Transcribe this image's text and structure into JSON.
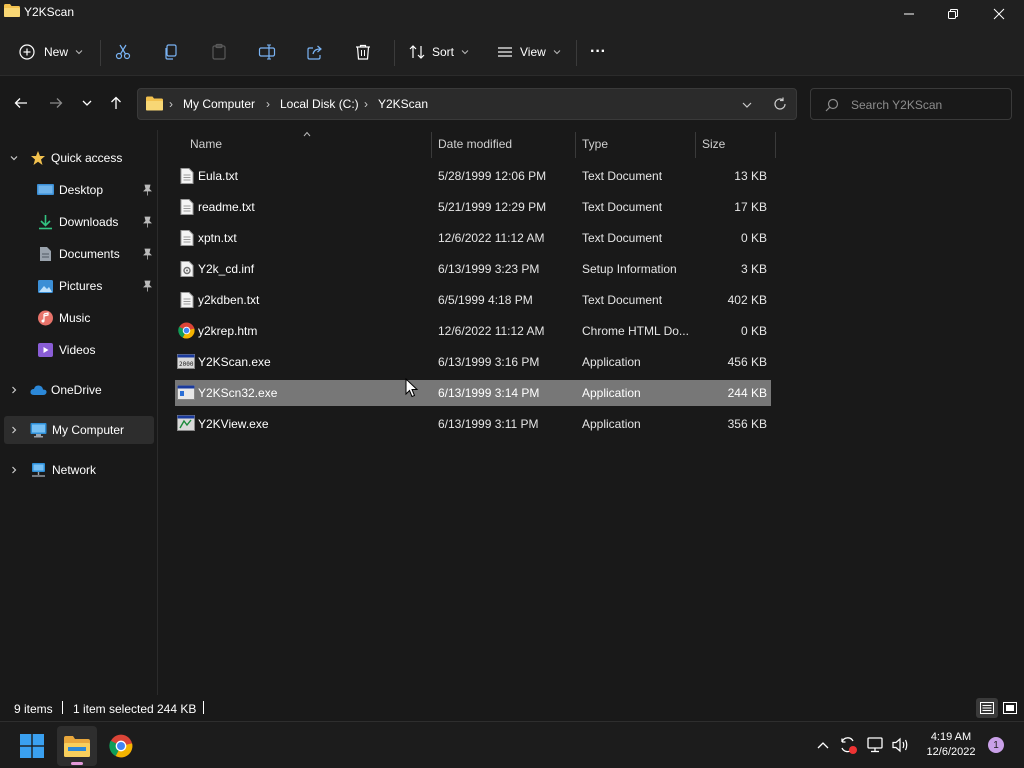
{
  "window": {
    "title": "Y2KScan"
  },
  "toolbar": {
    "new_label": "New",
    "sort_label": "Sort",
    "view_label": "View",
    "more_label": "···"
  },
  "address": {
    "crumbs": [
      "My Computer",
      "Local Disk (C:)",
      "Y2KScan"
    ],
    "search_placeholder": "Search Y2KScan"
  },
  "nav": {
    "quick_access": "Quick access",
    "items": [
      {
        "label": "Desktop",
        "icon": "desktop-icon"
      },
      {
        "label": "Downloads",
        "icon": "download-icon"
      },
      {
        "label": "Documents",
        "icon": "document-icon"
      },
      {
        "label": "Pictures",
        "icon": "pictures-icon"
      },
      {
        "label": "Music",
        "icon": "music-icon"
      },
      {
        "label": "Videos",
        "icon": "videos-icon"
      }
    ],
    "onedrive": "OneDrive",
    "my_computer": "My Computer",
    "network": "Network"
  },
  "columns": {
    "name": "Name",
    "date": "Date modified",
    "type": "Type",
    "size": "Size"
  },
  "files": [
    {
      "name": "Eula.txt",
      "date": "5/28/1999 12:06 PM",
      "type": "Text Document",
      "size": "13 KB",
      "icon": "text-file-icon"
    },
    {
      "name": "readme.txt",
      "date": "5/21/1999 12:29 PM",
      "type": "Text Document",
      "size": "17 KB",
      "icon": "text-file-icon"
    },
    {
      "name": "xptn.txt",
      "date": "12/6/2022 11:12 AM",
      "type": "Text Document",
      "size": "0 KB",
      "icon": "text-file-icon"
    },
    {
      "name": "Y2k_cd.inf",
      "date": "6/13/1999 3:23 PM",
      "type": "Setup Information",
      "size": "3 KB",
      "icon": "setup-info-icon"
    },
    {
      "name": "y2kdben.txt",
      "date": "6/5/1999 4:18 PM",
      "type": "Text Document",
      "size": "402 KB",
      "icon": "text-file-icon"
    },
    {
      "name": "y2krep.htm",
      "date": "12/6/2022 11:12 AM",
      "type": "Chrome HTML Do...",
      "size": "0 KB",
      "icon": "chrome-icon"
    },
    {
      "name": "Y2KScan.exe",
      "date": "6/13/1999 3:16 PM",
      "type": "Application",
      "size": "456 KB",
      "icon": "application-icon"
    },
    {
      "name": "Y2KScn32.exe",
      "date": "6/13/1999 3:14 PM",
      "type": "Application",
      "size": "244 KB",
      "icon": "application-icon",
      "selected": true
    },
    {
      "name": "Y2KView.exe",
      "date": "6/13/1999 3:11 PM",
      "type": "Application",
      "size": "356 KB",
      "icon": "application-icon"
    }
  ],
  "status": {
    "items": "9 items",
    "selected": "1 item selected",
    "size": "244 KB"
  },
  "taskbar": {
    "time": "4:19 AM",
    "date": "12/6/2022",
    "notification_count": "1"
  },
  "colors": {
    "selection": "#777777",
    "folder": "#f2c14e",
    "accent": "#0078d4"
  }
}
